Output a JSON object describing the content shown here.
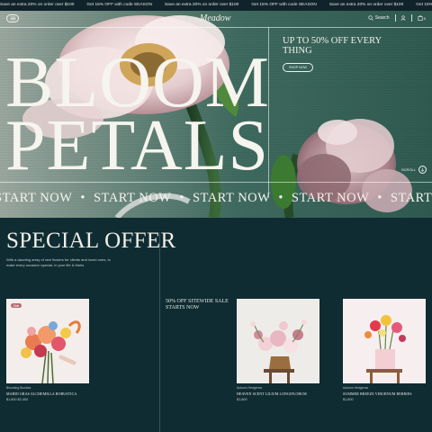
{
  "ticker": {
    "items": [
      "Save an extra 20% on order over $100",
      "Get 15% OFF with code SEASON",
      "Save an extra 20% on order over $100",
      "Get 15% OFF with code SEASON",
      "Save an extra 20% on order over $100",
      "Get 15% OFF with code SEASON",
      "Save an extra 20% on order over $100",
      "Get 15% OFF with code SEASON"
    ]
  },
  "nav": {
    "logo": "Meadow",
    "search_label": "Search",
    "icons": [
      "menu-icon",
      "search-icon",
      "user-icon",
      "cart-icon"
    ],
    "cart_count": "0"
  },
  "hero": {
    "headline_line1": "BLOOM",
    "headline_line2": "PETALS",
    "offer_text": "UP TO 50% OFF EVERY THING",
    "shop_button": "SHOP NOW",
    "scroll_label": "SCROLL",
    "marquee_text": "START NOW",
    "marquee_repeat": 6
  },
  "special": {
    "title": "SPECIAL OFFER",
    "description": "With a dazzling array of rare flowers for clients and loved ones, to make every occasion special, in your life & theirs",
    "sitewide_text": "50% OFF SITEWIDE SALE STARTS NOW"
  },
  "products": [
    {
      "badge": "Sale",
      "category": "Blooming Bundles",
      "name": "MARDI GRAS ALCHEMILLA ROBUSTICA",
      "price": "$1,800 $2,400"
    },
    {
      "category": "Autumn Hedgerow",
      "name": "HEAVEN SCENT LILIUM LONGIFLORUM",
      "price": "$1,800"
    },
    {
      "category": "Autumn Hedgerow",
      "name": "SUMMER BREEZE VIBURNUM BERRIES",
      "price": "$1,800"
    }
  ],
  "colors": {
    "hero_green": "#3f6a5f",
    "dark_teal": "#0f2c33",
    "sale_badge": "#b86c71"
  }
}
